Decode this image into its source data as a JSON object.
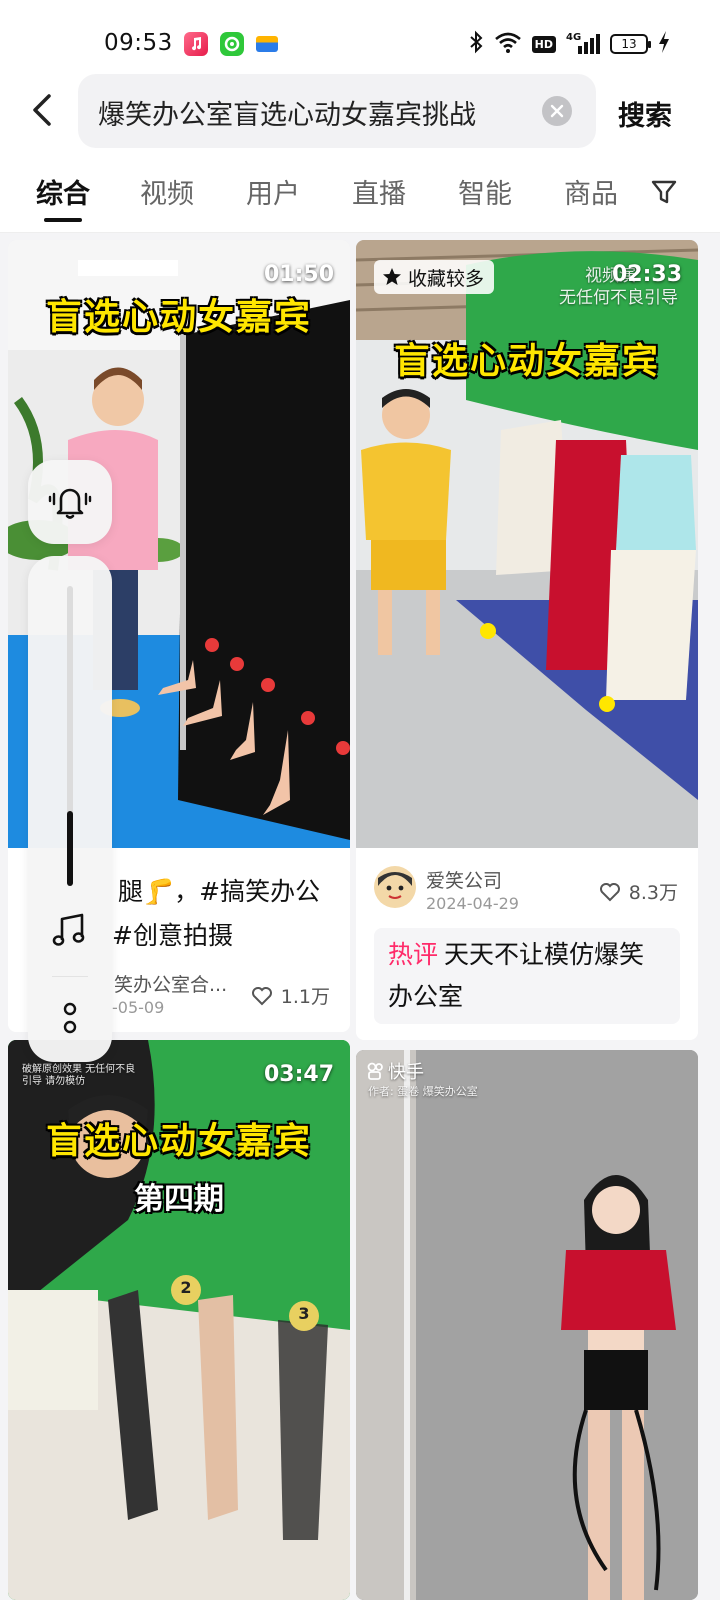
{
  "status_bar": {
    "time": "09:53",
    "hd": "HD",
    "network": "4G",
    "battery": "13",
    "icons": [
      "music-app-icon",
      "green-app-icon",
      "card-app-icon",
      "bluetooth-icon",
      "wifi-icon",
      "signal-icon",
      "charging-icon"
    ]
  },
  "search": {
    "query": "爆笑办公室盲选心动女嘉宾挑战",
    "submit_label": "搜索"
  },
  "tabs": [
    {
      "label": "综合",
      "active": true
    },
    {
      "label": "视频"
    },
    {
      "label": "用户"
    },
    {
      "label": "直播"
    },
    {
      "label": "智能"
    },
    {
      "label": "商品"
    }
  ],
  "cards": [
    {
      "duration": "01:50",
      "overlay_title": "盲选心动女嘉宾",
      "title_line1": "腿🦵，#搞笑办公",
      "title_line2": "#创意拍摄",
      "author": "笑办公室合...",
      "date": "-05-09",
      "likes": "1.1万"
    },
    {
      "badge": "收藏较多",
      "watermark_line1": "视频演",
      "watermark_line2": "无任何不良引导",
      "duration": "02:33",
      "overlay_title": "盲选心动女嘉宾",
      "author": "爱笑公司",
      "date": "2024-04-29",
      "likes": "8.3万",
      "hot_label": "热评",
      "hot_comment": "天天不让模仿爆笑办公室"
    },
    {
      "duration": "03:47",
      "watermark": "破解原创效果 无任何不良引导 请勿模仿",
      "overlay_title": "盲选心动女嘉宾",
      "overlay_sub": "第四期",
      "numbers": [
        "2",
        "3"
      ]
    },
    {
      "brand": "快手",
      "author_watermark": "作者: 蛋卷 爆笑办公室"
    }
  ],
  "quick_panel": {
    "volume_level": 0.25,
    "icons": [
      "bell-icon",
      "music-note-icon",
      "more-icon"
    ]
  },
  "colors": {
    "overlay_yellow": "#ffe600",
    "hot_pink": "#ff2b6a",
    "green_screen": "#2fa84a",
    "blue_mat": "#1e8be0"
  }
}
